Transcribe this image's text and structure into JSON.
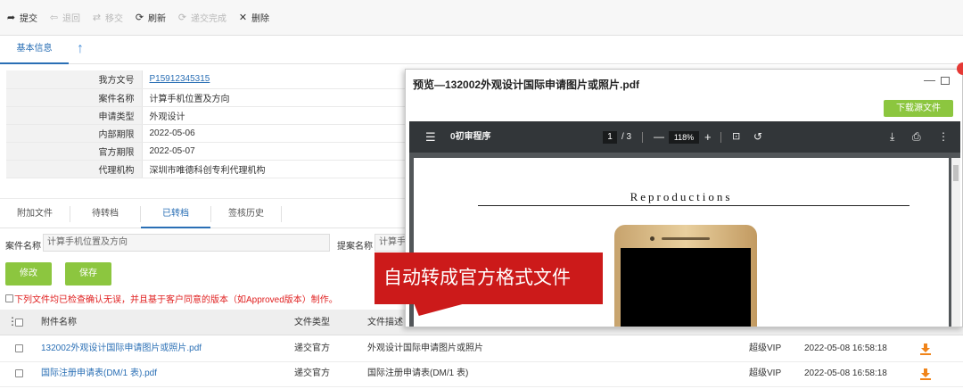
{
  "toolbar": {
    "submit": "提交",
    "back": "退回",
    "transfer": "移交",
    "refresh": "刷新",
    "submit_complete": "递交完成",
    "delete": "删除"
  },
  "top_tabs": {
    "basic_info": "基本信息"
  },
  "info": {
    "rows": [
      {
        "label": "我方文号",
        "value": "P15912345315"
      },
      {
        "label": "案件名称",
        "value": "计算手机位置及方向"
      },
      {
        "label": "申请类型",
        "value": "外观设计"
      },
      {
        "label": "内部期限",
        "value": "2022-05-06"
      },
      {
        "label": "官方期限",
        "value": "2022-05-07"
      },
      {
        "label": "代理机构",
        "value": "深圳市唯德科创专利代理机构"
      }
    ]
  },
  "sub_tabs": [
    "附加文件",
    "待转档",
    "已转档",
    "签核历史"
  ],
  "filter": {
    "case_name_label": "案件名称",
    "case_name_value": "计算手机位置及方向",
    "proposal_name_label": "提案名称",
    "proposal_name_value": "计算手"
  },
  "buttons": {
    "modify": "修改",
    "save": "保存"
  },
  "warning": "下列文件均已检查确认无误，并且基于客户同意的版本（如Approved版本）制作。",
  "file_table": {
    "headers": {
      "name": "附件名称",
      "type": "文件类型",
      "desc": "文件描述"
    },
    "rows": [
      {
        "name": "132002外观设计国际申请图片或照片.pdf",
        "type": "递交官方",
        "desc": "外观设计国际申请图片或照片",
        "user": "超级VIP",
        "time": "2022-05-08 16:58:18"
      },
      {
        "name": "国际注册申请表(DM/1 表).pdf",
        "type": "递交官方",
        "desc": "国际注册申请表(DM/1 表)",
        "user": "超级VIP",
        "time": "2022-05-08 16:58:18"
      }
    ]
  },
  "preview": {
    "title": "预览—132002外观设计国际申请图片或照片.pdf",
    "download_button": "下载源文件",
    "viewer": {
      "doc_name": "0初审程序",
      "page_current": "1",
      "page_total": "/  3",
      "zoom": "118%",
      "heading": "Reproductions"
    }
  },
  "callout": "自动转成官方格式文件",
  "colors": {
    "accent_blue": "#2a6fb5",
    "green": "#8cc63f",
    "callout_red": "#cc1a1a"
  }
}
